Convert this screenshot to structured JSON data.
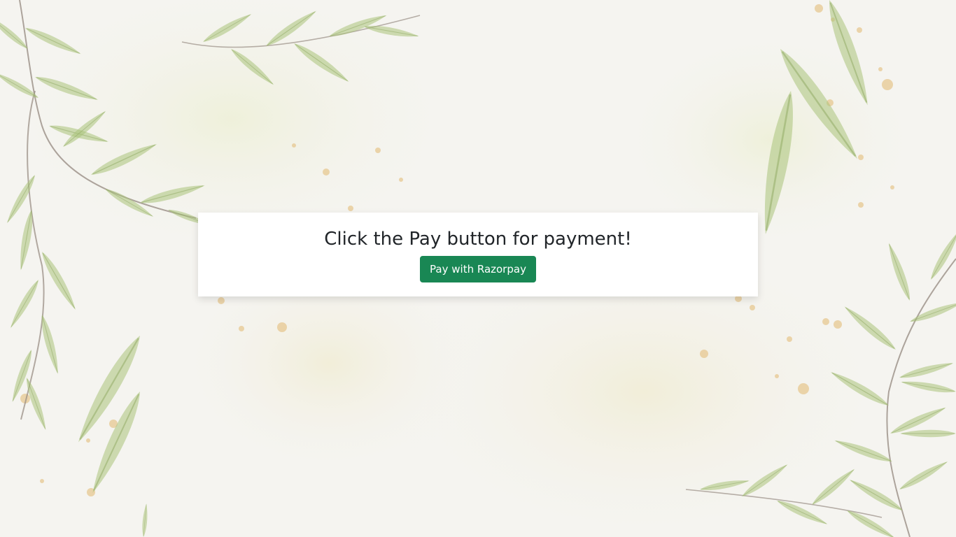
{
  "card": {
    "heading": "Click the Pay button for payment!",
    "pay_button_label": "Pay with Razorpay"
  },
  "colors": {
    "button": "#198754",
    "button_text": "#ffffff",
    "heading_text": "#212529",
    "card_background": "#ffffff",
    "page_background": "#f4f3ef",
    "leaf_green": "#9cb86a",
    "splatter_gold": "#e6c48a"
  },
  "background": {
    "description_icon": "watercolor-leaves-background"
  }
}
